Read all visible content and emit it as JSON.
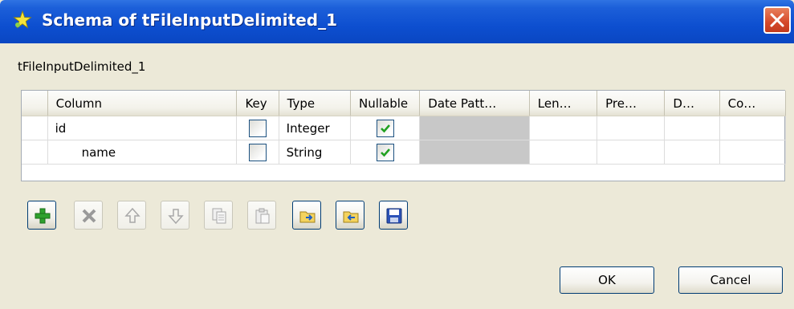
{
  "window": {
    "title": "Schema of tFileInputDelimited_1"
  },
  "component_label": "tFileInputDelimited_1",
  "table": {
    "headers": [
      "",
      "Column",
      "Key",
      "Type",
      "Nullable",
      "Date Patt…",
      "Len…",
      "Pre…",
      "D…",
      "Co…"
    ],
    "rows": [
      {
        "column": "id",
        "key": false,
        "type": "Integer",
        "nullable": true,
        "date_pattern": "",
        "length": "",
        "precision": "",
        "default": "",
        "comment": ""
      },
      {
        "column": "name",
        "key": false,
        "type": "String",
        "nullable": true,
        "date_pattern": "",
        "length": "",
        "precision": "",
        "default": "",
        "comment": ""
      }
    ]
  },
  "toolbar": [
    {
      "icon": "add-icon",
      "enabled": true
    },
    {
      "icon": "remove-icon",
      "enabled": false
    },
    {
      "icon": "move-up-icon",
      "enabled": false
    },
    {
      "icon": "move-down-icon",
      "enabled": false
    },
    {
      "icon": "copy-icon",
      "enabled": false
    },
    {
      "icon": "paste-icon",
      "enabled": false
    },
    {
      "icon": "import-icon",
      "enabled": true
    },
    {
      "icon": "export-icon",
      "enabled": true
    },
    {
      "icon": "save-icon",
      "enabled": true
    }
  ],
  "buttons": {
    "ok_label": "OK",
    "cancel_label": "Cancel"
  },
  "colors": {
    "titlebar": "#0a4fd0",
    "dialog_bg": "#ece9d8",
    "check": "#21a121",
    "close": "#d5492a"
  }
}
